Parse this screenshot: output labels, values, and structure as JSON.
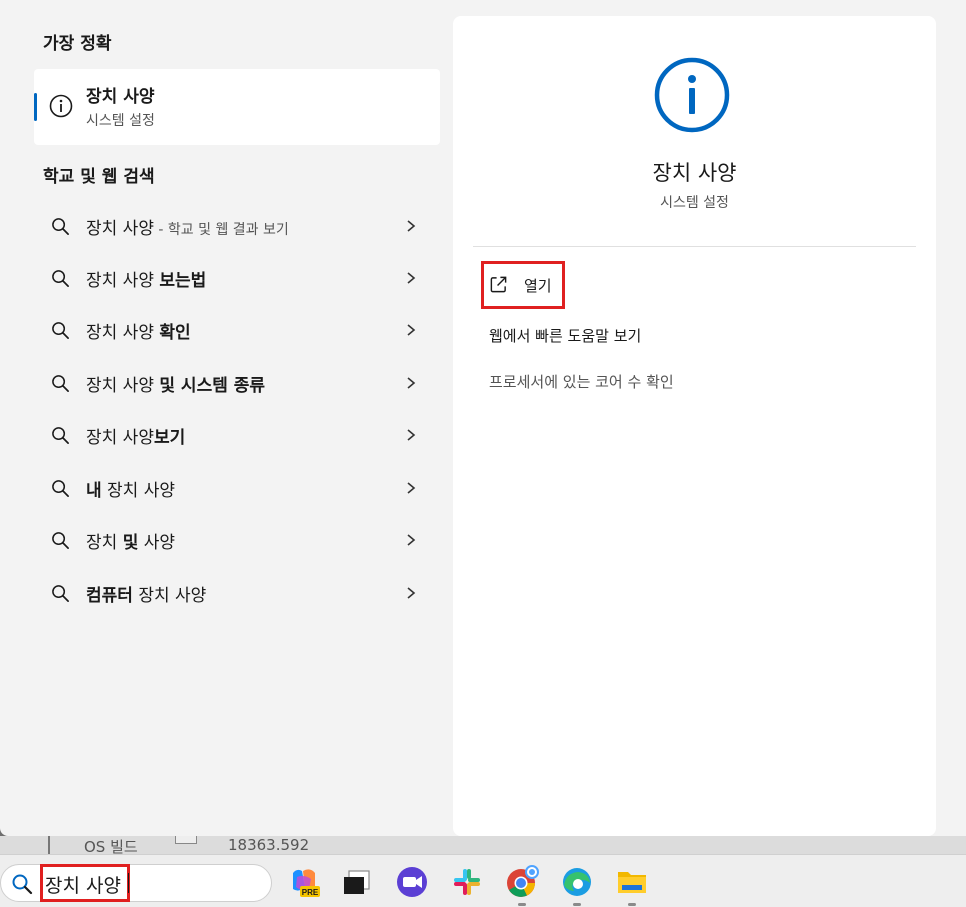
{
  "left": {
    "best_match_title": "가장 정확",
    "best_match": {
      "title": "장치 사양",
      "subtitle": "시스템 설정"
    },
    "web_title": "학교 및 웹 검색",
    "items": [
      {
        "plain": "장치 사양",
        "bold": "",
        "small": " - 학교 및 웹 결과 보기"
      },
      {
        "plain": "장치 사양 ",
        "bold": "보는법",
        "small": ""
      },
      {
        "plain": "장치 사양 ",
        "bold": "확인",
        "small": ""
      },
      {
        "plain": "장치 사양 ",
        "bold": "및 시스템 종류",
        "small": ""
      },
      {
        "plain": "장치 사양",
        "bold": "보기",
        "small": ""
      },
      {
        "bold_first": "내",
        "plain_after": " 장치 사양"
      },
      {
        "plain": "장치 ",
        "bold": "및",
        "plain_after": " 사양"
      },
      {
        "bold_first": "컴퓨터",
        "plain_after": " 장치 사양"
      }
    ]
  },
  "right": {
    "title": "장치 사양",
    "subtitle": "시스템 설정",
    "actions": {
      "open": "열기",
      "web_help": "웹에서 빠른 도움말 보기",
      "cores": "프로세서에 있는 코어 수 확인"
    }
  },
  "background": {
    "left_text": "OS 빌드",
    "right_text": "18363.592"
  },
  "taskbar": {
    "search_query": "장치 사양",
    "apps": [
      "copilot-pre-icon",
      "task-view-icon",
      "zoom-icon",
      "slack-icon",
      "chrome-icon",
      "edge-icon",
      "file-explorer-icon"
    ]
  },
  "colors": {
    "accent": "#0067c0",
    "highlight_box": "#e02020"
  }
}
